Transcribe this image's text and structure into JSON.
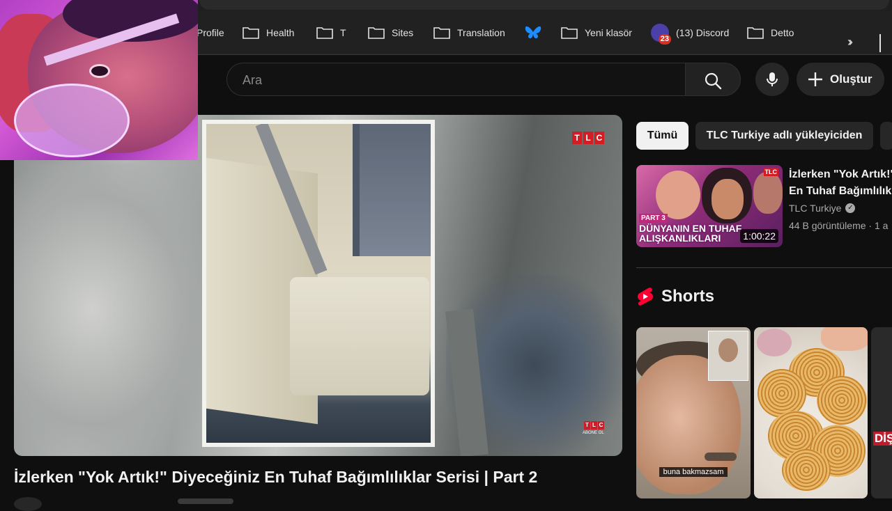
{
  "bookmarks": [
    {
      "label": "Profile",
      "icon": "folder-icon"
    },
    {
      "label": "Health",
      "icon": "folder-icon"
    },
    {
      "label": "T",
      "icon": "folder-icon"
    },
    {
      "label": "Sites",
      "icon": "folder-icon"
    },
    {
      "label": "Translation",
      "icon": "folder-icon"
    },
    {
      "label": "",
      "icon": "butterfly-icon"
    },
    {
      "label": "Yeni klasör",
      "icon": "folder-icon"
    },
    {
      "label": "(13) Discord",
      "icon": "discord-icon",
      "badge": "23"
    },
    {
      "label": "Detto",
      "icon": "folder-icon"
    }
  ],
  "header": {
    "search_placeholder": "Ara",
    "create_label": "Oluştur"
  },
  "player": {
    "watermark": "TLC",
    "corner_logo": "TLC",
    "corner_sub": "ABONE OL"
  },
  "video": {
    "title": "İzlerken \"Yok Artık!\" Diyeceğiniz En Tuhaf Bağımlılıklar Serisi | Part 2"
  },
  "chips": {
    "all": "Tümü",
    "tlc": "TLC Turkiye adlı yükleyiciden"
  },
  "recommended": {
    "title_line1": "İzlerken \"Yok Artık!\"",
    "title_line2": "En Tuhaf Bağımlılık",
    "channel": "TLC Turkiye",
    "meta": "44 B görüntüleme · 1 a",
    "duration": "1:00:22",
    "thumb_part": "PART 3",
    "thumb_text": "DÜNYANIN EN TUHAF ALIŞKANLIKLARI",
    "thumb_logo": "TLC"
  },
  "shorts": {
    "heading": "Shorts",
    "items": [
      {
        "caption": "buna bakmazsam"
      },
      {
        "caption": ""
      },
      {
        "caption": "DİŞ"
      }
    ]
  },
  "colors": {
    "background": "#0f0f0f",
    "accent_red": "#ff0033",
    "chip_active": "#f1f1f1",
    "tlc_red": "#d41c24"
  }
}
